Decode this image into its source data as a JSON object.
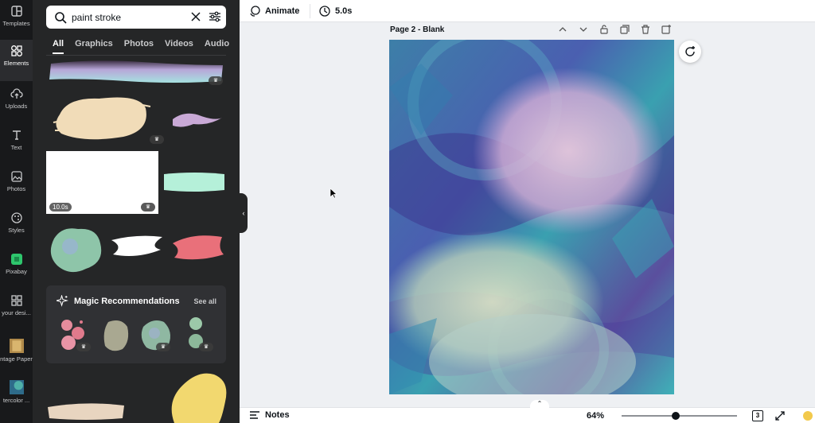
{
  "rail": {
    "items": [
      {
        "label": "Templates"
      },
      {
        "label": "Elements"
      },
      {
        "label": "Uploads"
      },
      {
        "label": "Text"
      },
      {
        "label": "Photos"
      },
      {
        "label": "Styles"
      },
      {
        "label": "Pixabay"
      },
      {
        "label": "your desi..."
      },
      {
        "label": "ntage Paper"
      },
      {
        "label": "tercolor ..."
      }
    ]
  },
  "search": {
    "value": "paint stroke"
  },
  "tabs": [
    "All",
    "Graphics",
    "Photos",
    "Videos",
    "Audio"
  ],
  "results": {
    "video_duration": "10.0s",
    "premium_icon": "crown-icon"
  },
  "magic": {
    "title": "Magic Recommendations",
    "see_all": "See all"
  },
  "topbar": {
    "animate": "Animate",
    "duration": "5.0s"
  },
  "page": {
    "title": "Page 2 - Blank"
  },
  "bottombar": {
    "notes": "Notes",
    "zoom": "64%",
    "zoom_level": 0.47,
    "page_count": "3"
  },
  "colors": {
    "rail_bg": "#18191b",
    "panel_bg": "#252627",
    "canvas_bg": "#eef0f3"
  }
}
